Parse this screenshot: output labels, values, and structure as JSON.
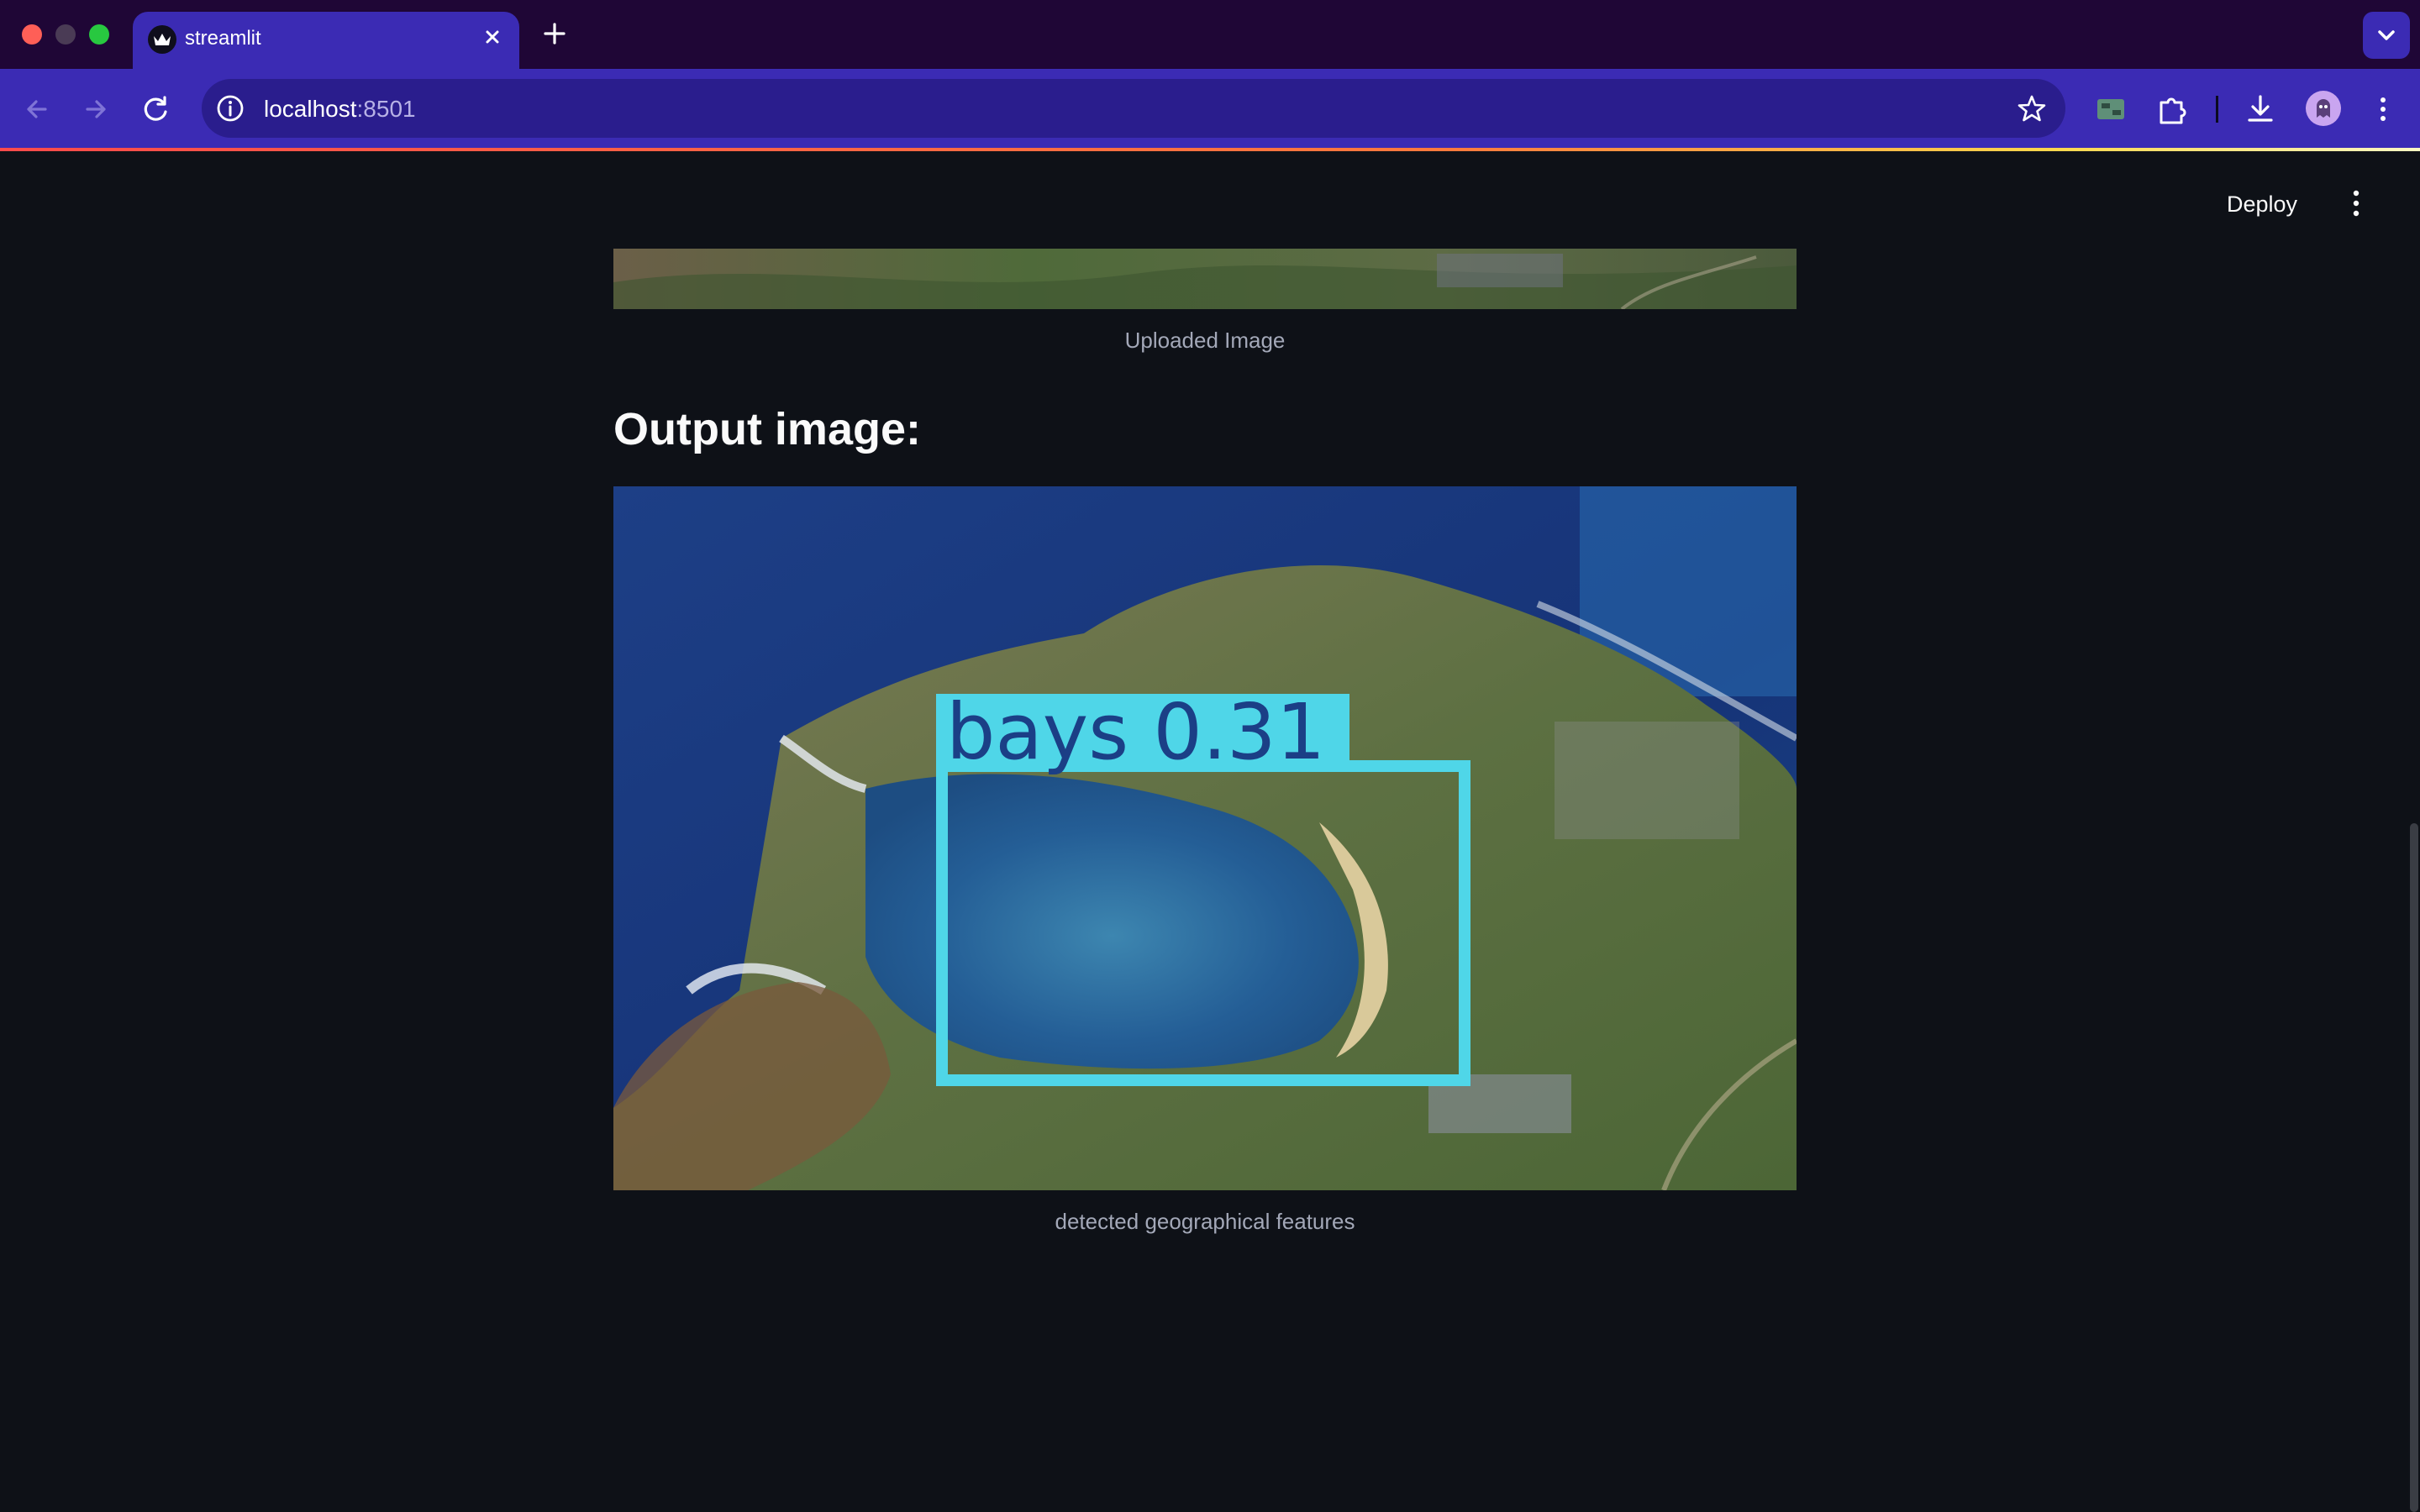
{
  "browser": {
    "tab_title": "streamlit",
    "url_host": "localhost",
    "url_port": ":8501"
  },
  "header": {
    "deploy_label": "Deploy"
  },
  "main": {
    "uploaded_caption": "Uploaded Image",
    "output_heading": "Output image:",
    "detection_label": "bays  0.31",
    "output_caption": "detected geographical features"
  },
  "colors": {
    "tab_bar": "#1f0636",
    "toolbar": "#3b2bb4",
    "app_background": "#0e1117",
    "detection_box": "#4fd6e8"
  }
}
